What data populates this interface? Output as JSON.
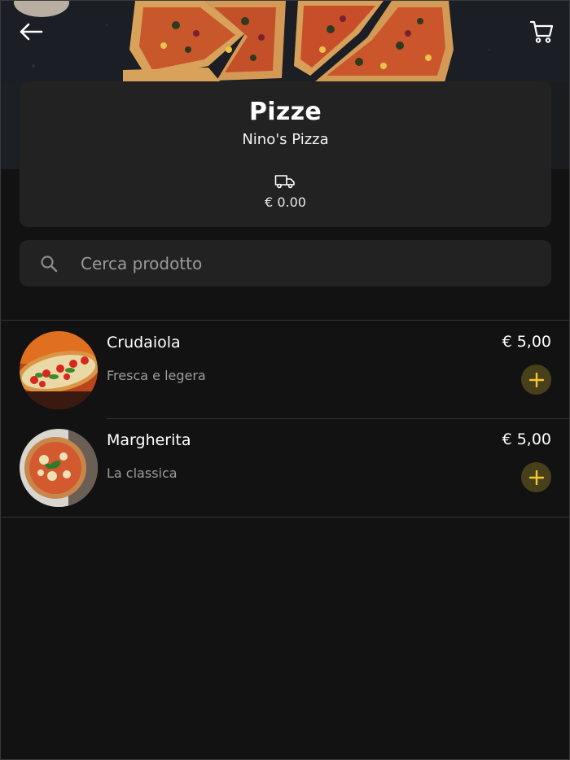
{
  "header": {
    "back_icon": "arrow-left-icon",
    "cart_icon": "shopping-cart-icon"
  },
  "shop": {
    "title": "Pizze",
    "subtitle": "Nino's Pizza",
    "delivery_icon": "truck-icon",
    "delivery_price": "€ 0.00"
  },
  "search": {
    "placeholder": "Cerca prodotto",
    "value": "",
    "icon": "search-icon"
  },
  "products": [
    {
      "name": "Crudaiola",
      "description": "Fresca e legera",
      "price": "€ 5,00"
    },
    {
      "name": "Margherita",
      "description": "La classica",
      "price": "€ 5,00"
    }
  ],
  "colors": {
    "background": "#121212",
    "card": "#222222",
    "accent": "#f2c832",
    "add_button_bg": "#47401a"
  }
}
